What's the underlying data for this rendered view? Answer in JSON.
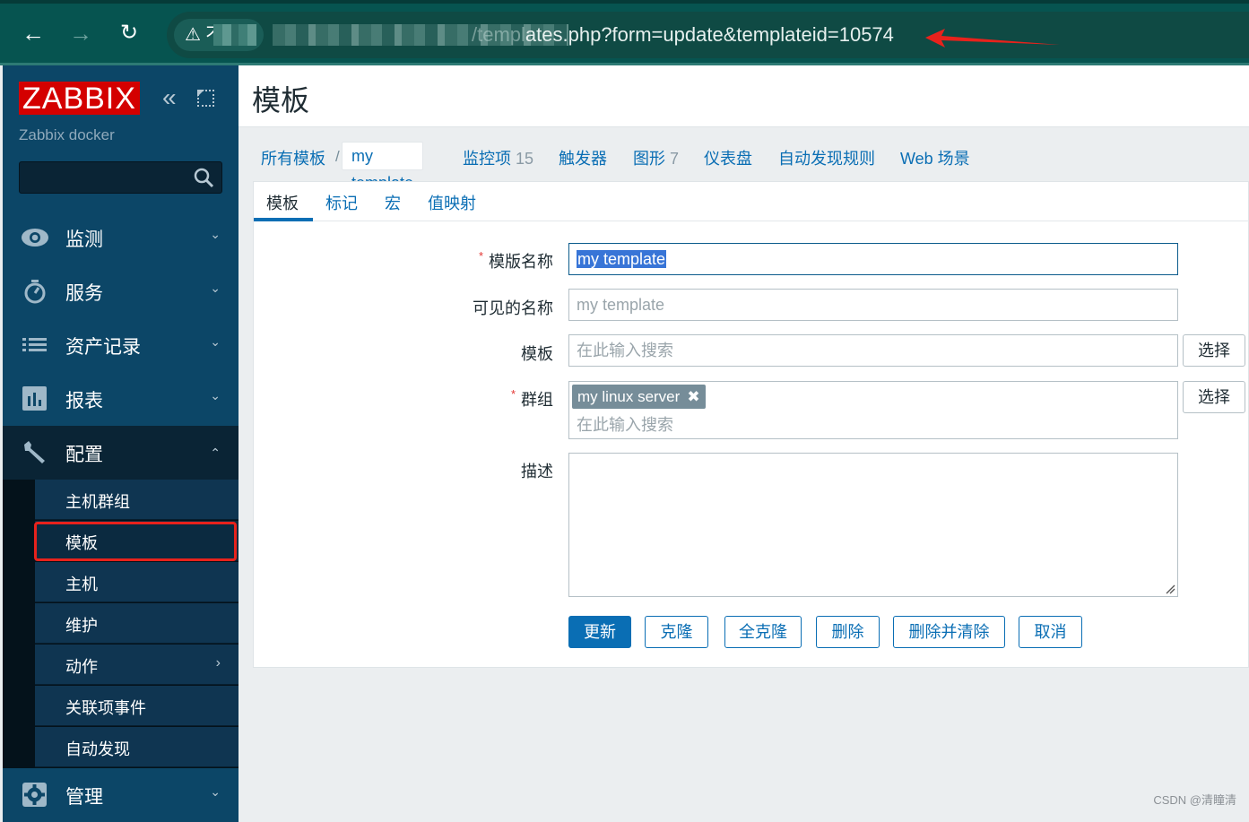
{
  "browser": {
    "security_label": "不",
    "url_visible": "/templates.php?form=update&templateid=10574",
    "url_partial_obscured": "/templ",
    "url_clear": "ates.php?form=update&templateid=10574"
  },
  "sidebar": {
    "logo": "ZABBIX",
    "server_name": "Zabbix docker",
    "search_value": "",
    "menu": [
      {
        "label": "监测",
        "icon": "eye-icon",
        "expanded": false
      },
      {
        "label": "服务",
        "icon": "stopwatch-icon",
        "expanded": false
      },
      {
        "label": "资产记录",
        "icon": "list-icon",
        "expanded": false
      },
      {
        "label": "报表",
        "icon": "bar-chart-icon",
        "expanded": false
      },
      {
        "label": "配置",
        "icon": "wrench-icon",
        "expanded": true
      },
      {
        "label": "管理",
        "icon": "gear-icon",
        "expanded": false
      }
    ],
    "config_submenu": [
      {
        "label": "主机群组"
      },
      {
        "label": "模板",
        "active": true
      },
      {
        "label": "主机"
      },
      {
        "label": "维护"
      },
      {
        "label": "动作",
        "has_submenu": true
      },
      {
        "label": "关联项事件"
      },
      {
        "label": "自动发现"
      }
    ]
  },
  "page": {
    "title": "模板"
  },
  "tabnav": {
    "all_templates": "所有模板",
    "separator": "/",
    "current": "my template",
    "items": {
      "label": "监控项",
      "count": "15"
    },
    "triggers": {
      "label": "触发器"
    },
    "graphs": {
      "label": "图形",
      "count": "7"
    },
    "dashboards": {
      "label": "仪表盘"
    },
    "discovery": {
      "label": "自动发现规则"
    },
    "web": {
      "label": "Web 场景"
    }
  },
  "form": {
    "tabs": [
      {
        "label": "模板",
        "active": true
      },
      {
        "label": "标记"
      },
      {
        "label": "宏"
      },
      {
        "label": "值映射"
      }
    ],
    "fields": {
      "template_name": {
        "label": "模版名称",
        "required": true,
        "value": "my template"
      },
      "visible_name": {
        "label": "可见的名称",
        "value": "",
        "placeholder": "my template"
      },
      "templates": {
        "label": "模板",
        "placeholder": "在此输入搜索",
        "select_label": "选择"
      },
      "groups": {
        "label": "群组",
        "required": true,
        "chips": [
          "my linux server"
        ],
        "placeholder": "在此输入搜索",
        "select_label": "选择"
      },
      "description": {
        "label": "描述",
        "value": ""
      }
    },
    "buttons": {
      "update": "更新",
      "clone": "克隆",
      "full_clone": "全克隆",
      "delete": "删除",
      "delete_and_clear": "删除并清除",
      "cancel": "取消"
    }
  },
  "watermark": "CSDN @清瞳清",
  "colors": {
    "brand": "#d40000",
    "sidebar": "#0c4667",
    "link": "#0a6eb4",
    "annotation": "#e8221c"
  }
}
